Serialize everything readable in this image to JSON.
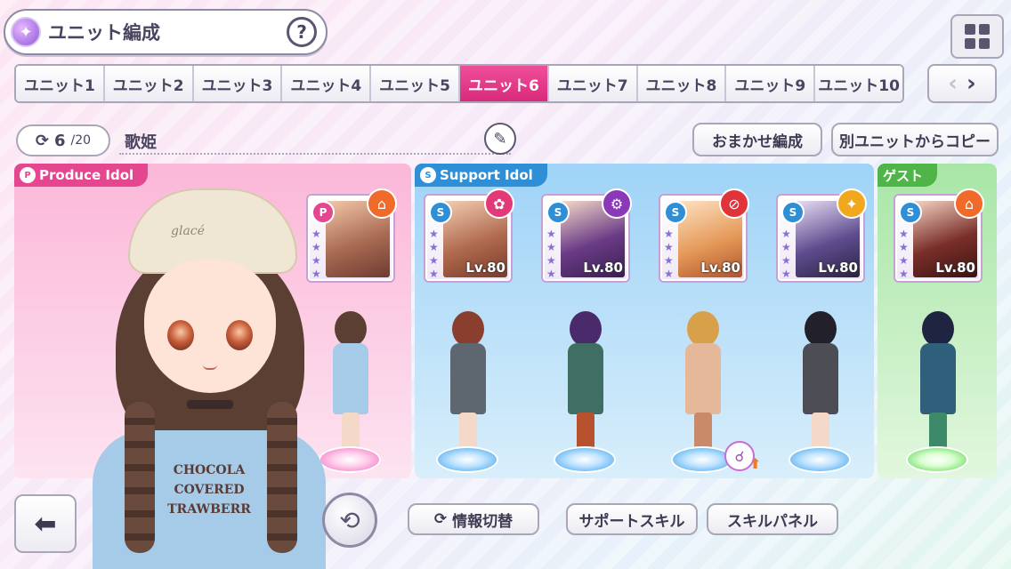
{
  "header": {
    "title": "ユニット編成",
    "help_label": "?"
  },
  "tabs": [
    {
      "label": "ユニット1",
      "active": false
    },
    {
      "label": "ユニット2",
      "active": false
    },
    {
      "label": "ユニット3",
      "active": false
    },
    {
      "label": "ユニット4",
      "active": false
    },
    {
      "label": "ユニット5",
      "active": false
    },
    {
      "label": "ユニット6",
      "active": true
    },
    {
      "label": "ユニット7",
      "active": false
    },
    {
      "label": "ユニット8",
      "active": false
    },
    {
      "label": "ユニット9",
      "active": false
    },
    {
      "label": "ユニット10",
      "active": false
    }
  ],
  "unit_info": {
    "count_current": "6",
    "count_total": "/20",
    "name": "歌姫"
  },
  "actions": {
    "auto_label": "おまかせ編成",
    "copy_label": "別ユニットからコピー",
    "info_toggle_label": "情報切替",
    "support_skill_label": "サポートスキル",
    "skill_panel_label": "スキルパネル"
  },
  "sections": {
    "produce_label": "Produce Idol",
    "support_label": "Support Idol",
    "guest_label": "ゲスト"
  },
  "cards": {
    "produce": {
      "level": ""
    },
    "support": [
      {
        "level": "Lv.80"
      },
      {
        "level": "Lv.80"
      },
      {
        "level": "Lv.80"
      },
      {
        "level": "Lv.80"
      }
    ],
    "guest": {
      "level": "Lv.80"
    }
  },
  "big_character": {
    "hat_text": "glacé",
    "shirt_lines": [
      "CHOCOLA",
      "COVERED",
      "TRAWBERR"
    ]
  },
  "colors": {
    "active_tab": "#e4468f",
    "produce": "#e4468f",
    "support": "#2f8fd6",
    "guest": "#4fb548"
  }
}
